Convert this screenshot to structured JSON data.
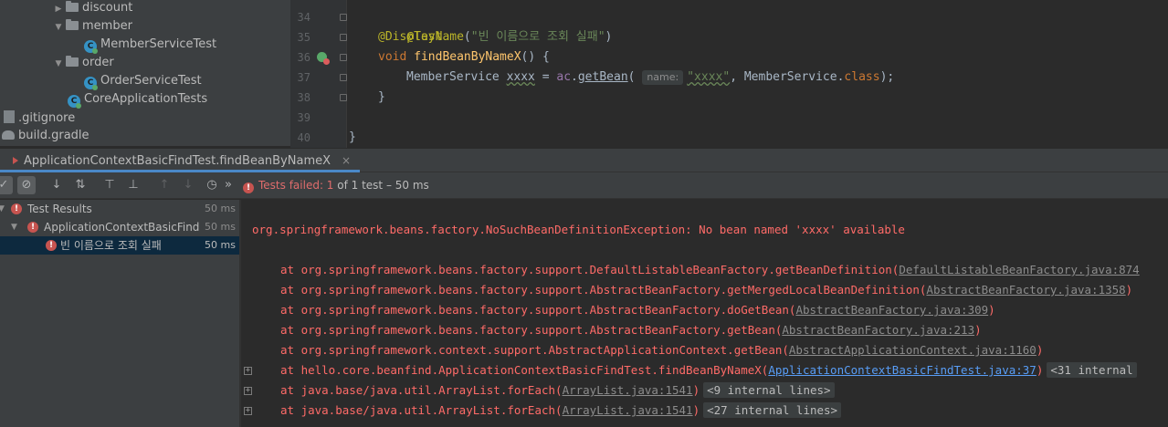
{
  "project_tree": {
    "items": [
      {
        "label": "discount",
        "kind": "folder",
        "state": "collapsed"
      },
      {
        "label": "member",
        "kind": "folder",
        "state": "expanded"
      },
      {
        "label": "MemberServiceTest",
        "kind": "test-class"
      },
      {
        "label": "order",
        "kind": "folder",
        "state": "expanded"
      },
      {
        "label": "OrderServiceTest",
        "kind": "test-class"
      },
      {
        "label": "CoreApplicationTests",
        "kind": "test-class"
      },
      {
        "label": ".gitignore",
        "kind": "file"
      },
      {
        "label": "build.gradle",
        "kind": "gradle"
      }
    ]
  },
  "editor": {
    "line_numbers": [
      "34",
      "35",
      "36",
      "37",
      "38",
      "39",
      "40"
    ],
    "line34": {
      "annotation": "@Test"
    },
    "line35": {
      "annotation": "@DisplayName",
      "paren_open": "(",
      "string": "\"빈 이름으로 조회 실패\"",
      "paren_close": ")"
    },
    "line36": {
      "keyword": "void",
      "method": "findBeanByNameX",
      "rest": "() {"
    },
    "line37": {
      "type": "MemberService",
      "var": "xxxx",
      "eq": " = ",
      "ac": "ac",
      "dot": ".",
      "method": "getBean",
      "paren": "(",
      "hint": "name:",
      "string": "\"xxxx\"",
      "mid": ", MemberService.",
      "kw_class": "class",
      "end": ");"
    },
    "line38": {
      "text": "}"
    },
    "line40": {
      "text": "}"
    }
  },
  "run_tab": {
    "title": "ApplicationContextBasicFindTest.findBeanByNameX",
    "close": "×"
  },
  "toolbar": {
    "more": "»",
    "status_failed": "Tests failed: 1",
    "status_rest": " of 1 test – 50 ms"
  },
  "test_tree": {
    "rows": [
      {
        "label": "Test Results",
        "duration": "50 ms"
      },
      {
        "label": "ApplicationContextBasicFind",
        "duration": "50 ms"
      },
      {
        "label": "빈 이름으로 조회 실패",
        "duration": "50 ms"
      }
    ]
  },
  "console": {
    "exception": "org.springframework.beans.factory.NoSuchBeanDefinitionException: No bean named 'xxxx' available",
    "frames": [
      {
        "prefix": "at org.springframework.beans.factory.support.DefaultListableBeanFactory.getBeanDefinition(",
        "link": "DefaultListableBeanFactory.java:874",
        "suffix": "",
        "folded": ""
      },
      {
        "prefix": "at org.springframework.beans.factory.support.AbstractBeanFactory.getMergedLocalBeanDefinition(",
        "link": "AbstractBeanFactory.java:1358",
        "suffix": ")",
        "folded": ""
      },
      {
        "prefix": "at org.springframework.beans.factory.support.AbstractBeanFactory.doGetBean(",
        "link": "AbstractBeanFactory.java:309",
        "suffix": ")",
        "folded": ""
      },
      {
        "prefix": "at org.springframework.beans.factory.support.AbstractBeanFactory.getBean(",
        "link": "AbstractBeanFactory.java:213",
        "suffix": ")",
        "folded": ""
      },
      {
        "prefix": "at org.springframework.context.support.AbstractApplicationContext.getBean(",
        "link": "AbstractApplicationContext.java:1160",
        "suffix": ")",
        "folded": ""
      },
      {
        "prefix": "at hello.core.beanfind.ApplicationContextBasicFindTest.findBeanByNameX(",
        "link": "ApplicationContextBasicFindTest.java:37",
        "suffix": ")",
        "folded": "<31 internal"
      },
      {
        "prefix": "at java.base/java.util.ArrayList.forEach(",
        "link": "ArrayList.java:1541",
        "suffix": ")",
        "folded": "<9 internal lines>"
      },
      {
        "prefix": "at java.base/java.util.ArrayList.forEach(",
        "link": "ArrayList.java:1541",
        "suffix": ")",
        "folded": "<27 internal lines>"
      }
    ]
  },
  "colors": {
    "error_red": "#ff6b68",
    "link_blue": "#589df6",
    "selection": "#0d293e",
    "annotation": "#bbb529",
    "keyword": "#cc7832",
    "string": "#6a8759",
    "method": "#ffc66d"
  }
}
